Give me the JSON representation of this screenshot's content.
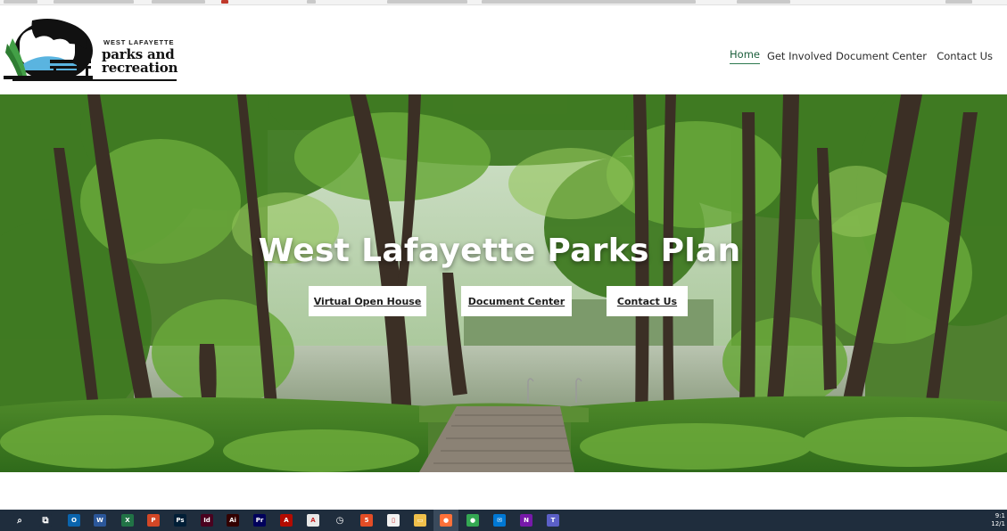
{
  "logo": {
    "line_small": "WEST LAFAYETTE",
    "line_big_1": "parks and",
    "line_big_2": "recreation"
  },
  "nav": {
    "items": [
      {
        "label": "Home",
        "active": true
      },
      {
        "label": "Get Involved",
        "active": false
      },
      {
        "label": "Document Center",
        "active": false
      },
      {
        "label": "Contact Us",
        "active": false
      }
    ]
  },
  "hero": {
    "title": "West Lafayette Parks Plan",
    "buttons": [
      {
        "label": "Virtual Open House"
      },
      {
        "label": "Document Center"
      },
      {
        "label": "Contact Us"
      }
    ]
  },
  "taskbar": {
    "icons": [
      {
        "name": "search-icon",
        "glyph": "⌕",
        "color": "#1f2d3d"
      },
      {
        "name": "task-view-icon",
        "glyph": "⧉",
        "color": "#1f2d3d"
      },
      {
        "name": "outlook-icon",
        "glyph": "O",
        "color": "#0a64ad"
      },
      {
        "name": "word-icon",
        "glyph": "W",
        "color": "#2b579a"
      },
      {
        "name": "excel-icon",
        "glyph": "X",
        "color": "#217346"
      },
      {
        "name": "powerpoint-icon",
        "glyph": "P",
        "color": "#d24726"
      },
      {
        "name": "photoshop-icon",
        "glyph": "Ps",
        "color": "#001e36"
      },
      {
        "name": "indesign-icon",
        "glyph": "Id",
        "color": "#49021f"
      },
      {
        "name": "illustrator-icon",
        "glyph": "Ai",
        "color": "#330000"
      },
      {
        "name": "premiere-icon",
        "glyph": "Pr",
        "color": "#00005b"
      },
      {
        "name": "acrobat-icon",
        "glyph": "A",
        "color": "#b30b00"
      },
      {
        "name": "acrobat-reader-icon",
        "glyph": "A",
        "color": "#e8e8e8"
      },
      {
        "name": "stopwatch-icon",
        "glyph": "◷",
        "color": "#1f2d3d"
      },
      {
        "name": "html-icon",
        "glyph": "5",
        "color": "#e44d26"
      },
      {
        "name": "notepad-icon",
        "glyph": "▯",
        "color": "#f2f2f2"
      },
      {
        "name": "file-explorer-icon",
        "glyph": "▭",
        "color": "#f0c04b"
      },
      {
        "name": "firefox-icon",
        "glyph": "●",
        "color": "#ff7139"
      },
      {
        "name": "chrome-icon",
        "glyph": "●",
        "color": "#34a853"
      },
      {
        "name": "mail-icon",
        "glyph": "✉",
        "color": "#0078d4"
      },
      {
        "name": "onenote-icon",
        "glyph": "N",
        "color": "#7719aa"
      },
      {
        "name": "teams-icon",
        "glyph": "T",
        "color": "#5b5fc7"
      }
    ],
    "clock_line_1": "9:1",
    "clock_line_2": "12/1"
  }
}
